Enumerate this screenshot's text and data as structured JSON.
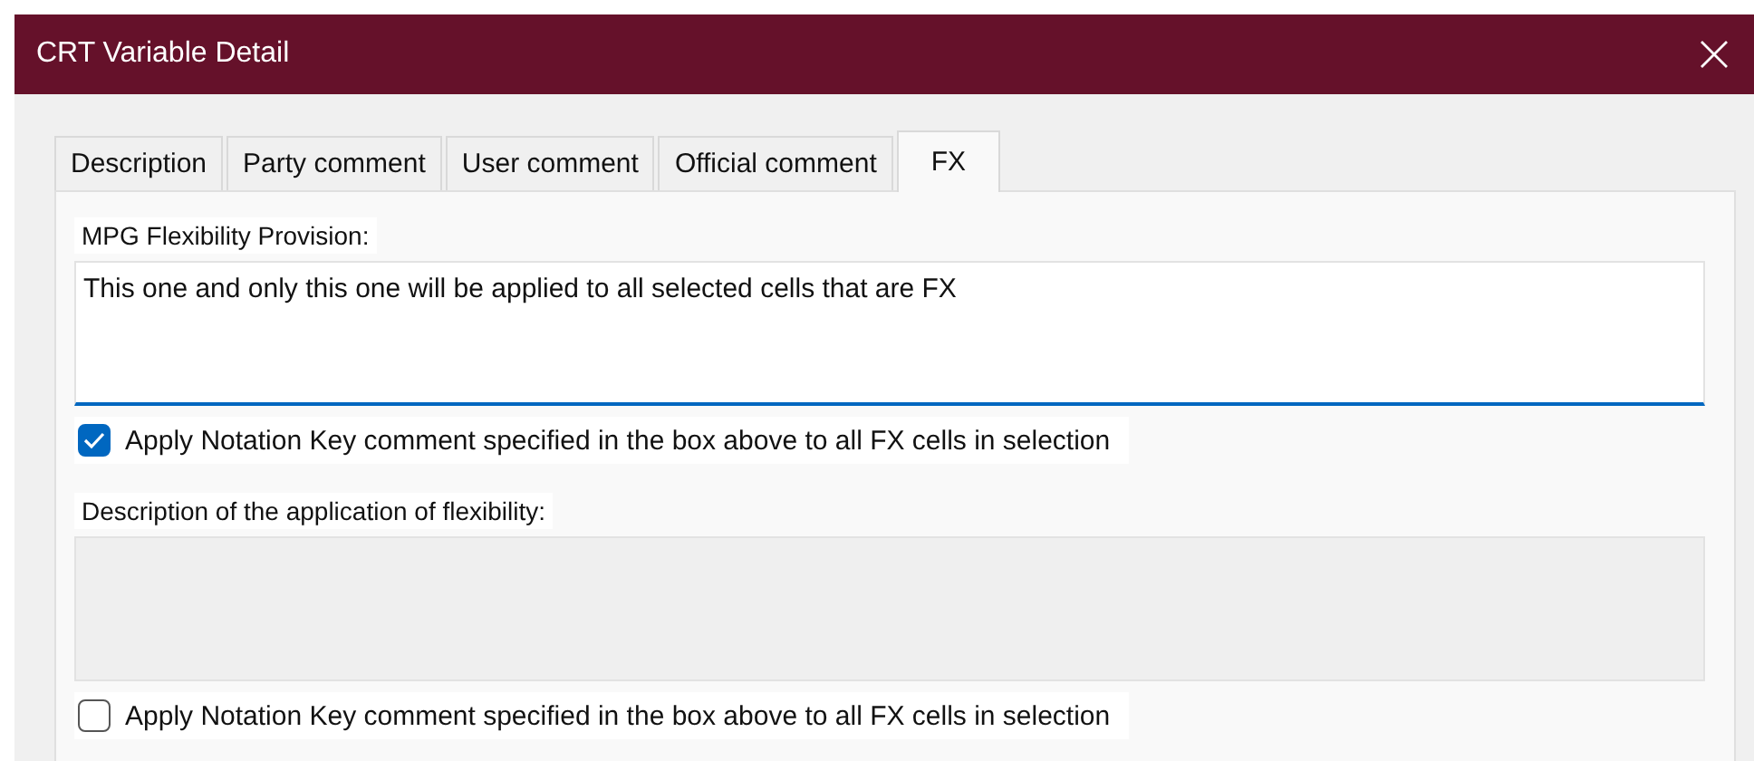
{
  "window": {
    "title": "CRT Variable Detail"
  },
  "tabs": [
    {
      "label": "Description",
      "selected": false
    },
    {
      "label": "Party comment",
      "selected": false
    },
    {
      "label": "User comment",
      "selected": false
    },
    {
      "label": "Official comment",
      "selected": false
    },
    {
      "label": "FX",
      "selected": true
    }
  ],
  "sections": [
    {
      "label": "MPG Flexibility Provision:",
      "value": "This one and only this one will be applied to all selected cells that are FX",
      "disabled": false,
      "checkbox": {
        "label": "Apply Notation Key comment specified in the box above to all FX cells in selection",
        "checked": true
      }
    },
    {
      "label": "Description of the application of flexibility:",
      "disabled": true,
      "checkbox": {
        "label": "Apply Notation Key comment specified in the box above to all FX cells in selection",
        "checked": false
      }
    }
  ]
}
